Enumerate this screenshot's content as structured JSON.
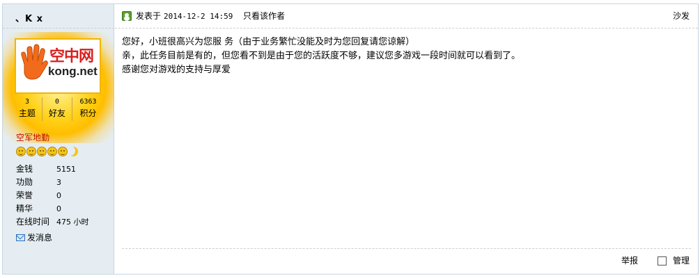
{
  "user": {
    "name": "、K x",
    "avatar": {
      "brand_cn": "空中网",
      "brand_en": "kong.net"
    },
    "stats": [
      {
        "value": "3",
        "label": "主题"
      },
      {
        "value": "0",
        "label": "好友"
      },
      {
        "value": "6363",
        "label": "积分"
      }
    ],
    "rank": "空军地勤",
    "info": [
      {
        "key": "金钱",
        "value": "5151"
      },
      {
        "key": "功勋",
        "value": "3"
      },
      {
        "key": "荣誉",
        "value": "0"
      },
      {
        "key": "精华",
        "value": "0"
      },
      {
        "key": "在线时间",
        "value": "475 小时"
      }
    ],
    "send_message": "发消息"
  },
  "post": {
    "posted_prefix": "发表于",
    "posted_time": "2014-12-2 14:59",
    "only_author": "只看该作者",
    "floor": "沙发",
    "lines": [
      "您好，小班很高兴为您服 务（由于业务繁忙没能及时为您回复请您谅解）",
      "亲，此任务目前是有的，但您看不到是由于您的活跃度不够，建议您多游戏一段时间就可以看到了。",
      "感谢您对游戏的支持与厚爱"
    ],
    "report": "举报",
    "manage": "管理"
  }
}
